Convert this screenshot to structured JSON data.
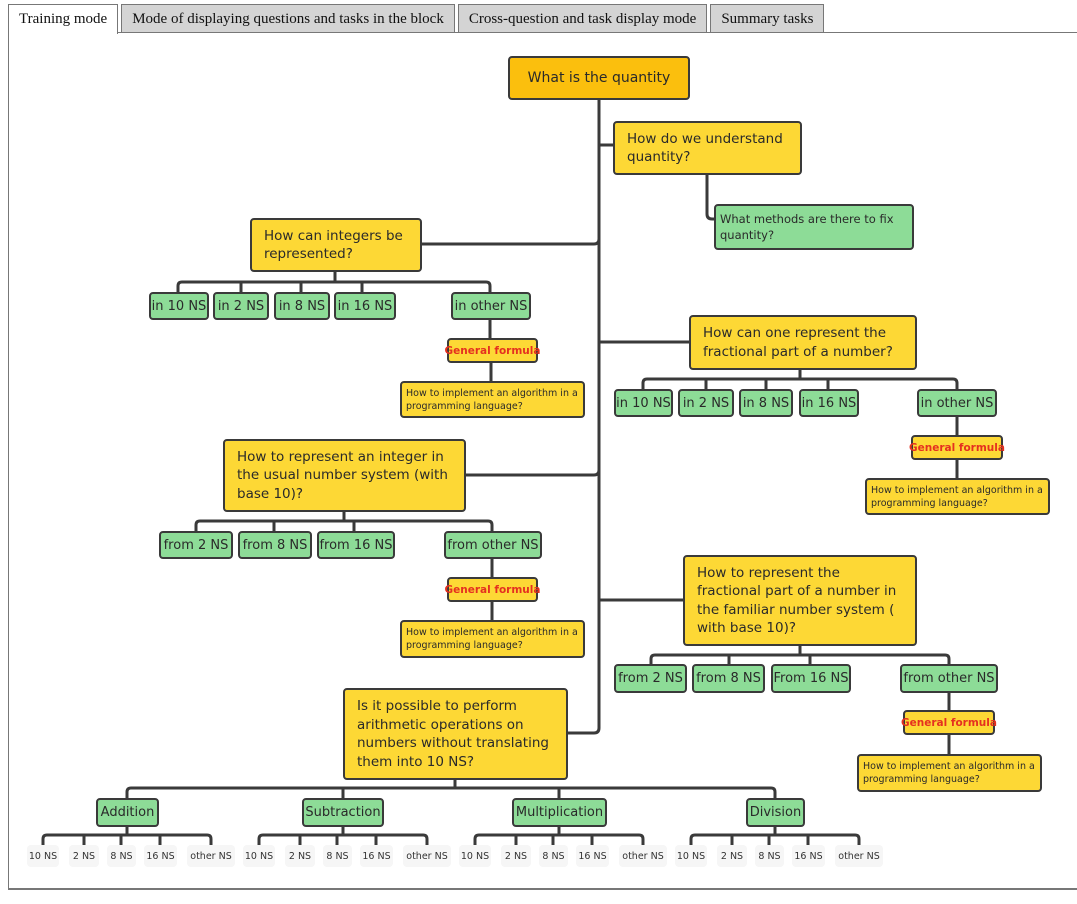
{
  "tabs": [
    {
      "label": "Training mode",
      "active": true
    },
    {
      "label": "Mode of displaying questions and tasks in the block",
      "active": false
    },
    {
      "label": "Cross-question and task display mode",
      "active": false
    },
    {
      "label": "Summary tasks",
      "active": false
    }
  ],
  "mindmap": {
    "root": "What is the quantity",
    "understand": {
      "question": "How do we understand quantity?",
      "child": "What methods are there to fix quantity?"
    },
    "integers": {
      "question": "How can integers be represented?",
      "options": [
        "in 10 NS",
        "in 2 NS",
        "in 8 NS",
        "in 16 NS",
        "in other NS"
      ],
      "formula": "General formula",
      "algorithm": "How to implement an algorithm in a programming language?"
    },
    "fractional": {
      "question": "How can one represent the fractional part of a number?",
      "options": [
        "in 10 NS",
        "in 2 NS",
        "in 8 NS",
        "in 16 NS",
        "in other NS"
      ],
      "formula": "General formula",
      "algorithm": "How to implement an algorithm in a programming language?"
    },
    "integer_to_10": {
      "question": "How to represent an integer in the usual number system (with base 10)?",
      "options": [
        "from 2 NS",
        "from 8 NS",
        "from 16 NS",
        "from other NS"
      ],
      "formula": "General formula",
      "algorithm": "How to implement an algorithm in a programming language?"
    },
    "fraction_to_10": {
      "question": "How to represent the fractional part of a number in the familiar number system ( with base 10)?",
      "options": [
        "from 2 NS",
        "from 8 NS",
        "From 16 NS",
        "from other NS"
      ],
      "formula": "General formula",
      "algorithm": "How to implement an algorithm in a programming language?"
    },
    "arithmetic": {
      "question": "Is it possible to perform arithmetic operations on numbers without translating them into 10 NS?",
      "operations": [
        {
          "label": "Addition",
          "leaves": [
            "10 NS",
            "2 NS",
            "8 NS",
            "16 NS",
            "other NS"
          ]
        },
        {
          "label": "Subtraction",
          "leaves": [
            "10 NS",
            "2 NS",
            "8 NS",
            "16 NS",
            "other NS"
          ]
        },
        {
          "label": "Multiplication",
          "leaves": [
            "10 NS",
            "2 NS",
            "8 NS",
            "16 NS",
            "other NS"
          ]
        },
        {
          "label": "Division",
          "leaves": [
            "10 NS",
            "2 NS",
            "8 NS",
            "16 NS",
            "other NS"
          ]
        }
      ]
    }
  },
  "colors": {
    "root": "#fbbf0d",
    "question": "#fdd835",
    "answer": "#8ddc97",
    "formula_text": "#e53020",
    "leaf": "#f6f6f6",
    "line": "#3a3a3a"
  }
}
